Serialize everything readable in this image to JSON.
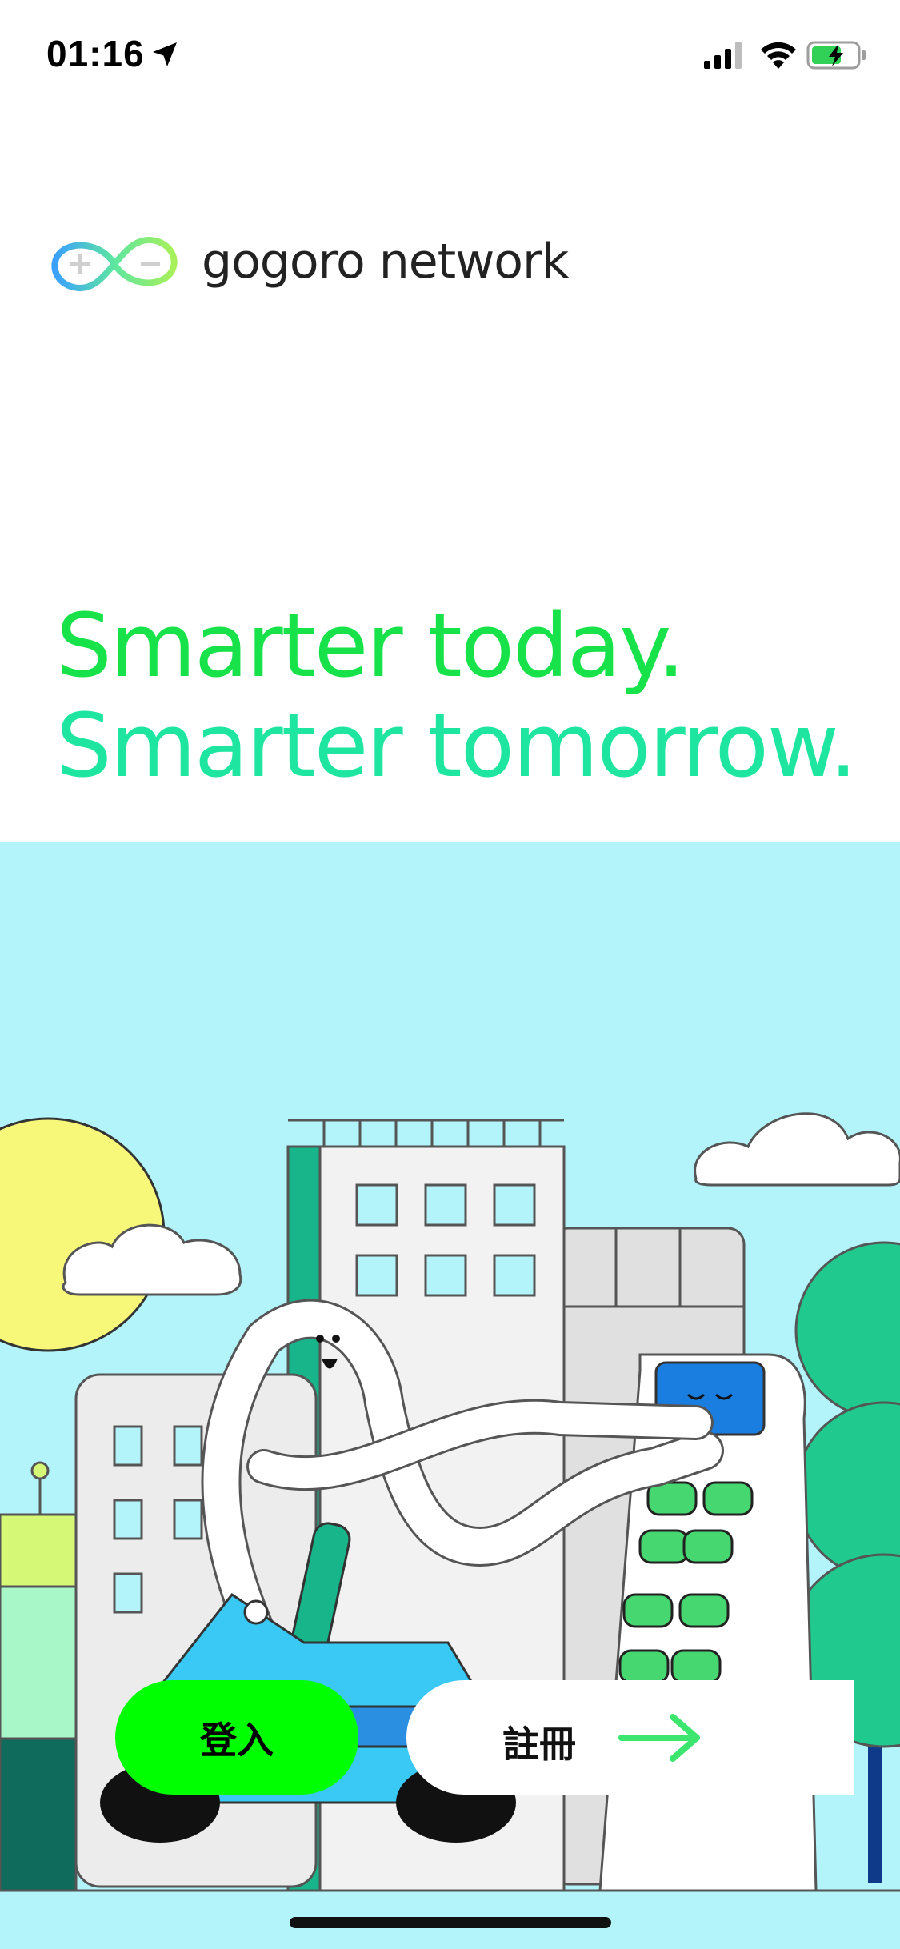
{
  "status_bar": {
    "time": "01:16",
    "icons": [
      "location-arrow-icon",
      "cellular-signal-icon",
      "wifi-icon",
      "battery-charging-icon"
    ]
  },
  "brand": {
    "logo_icon": "gogoro-network-infinity-logo-icon",
    "name_part1": "gogoro",
    "name_part2": " network"
  },
  "headline": {
    "line1": "Smarter today.",
    "line2": "Smarter tomorrow."
  },
  "actions": {
    "login_label": "登入",
    "register_label": "註冊",
    "register_icon": "arrow-right-icon"
  },
  "colors": {
    "headline_line1": "#17e24a",
    "headline_line2": "#1ee6a0",
    "login_button": "#00ff00",
    "scene_sky": "#b3f4fb"
  }
}
